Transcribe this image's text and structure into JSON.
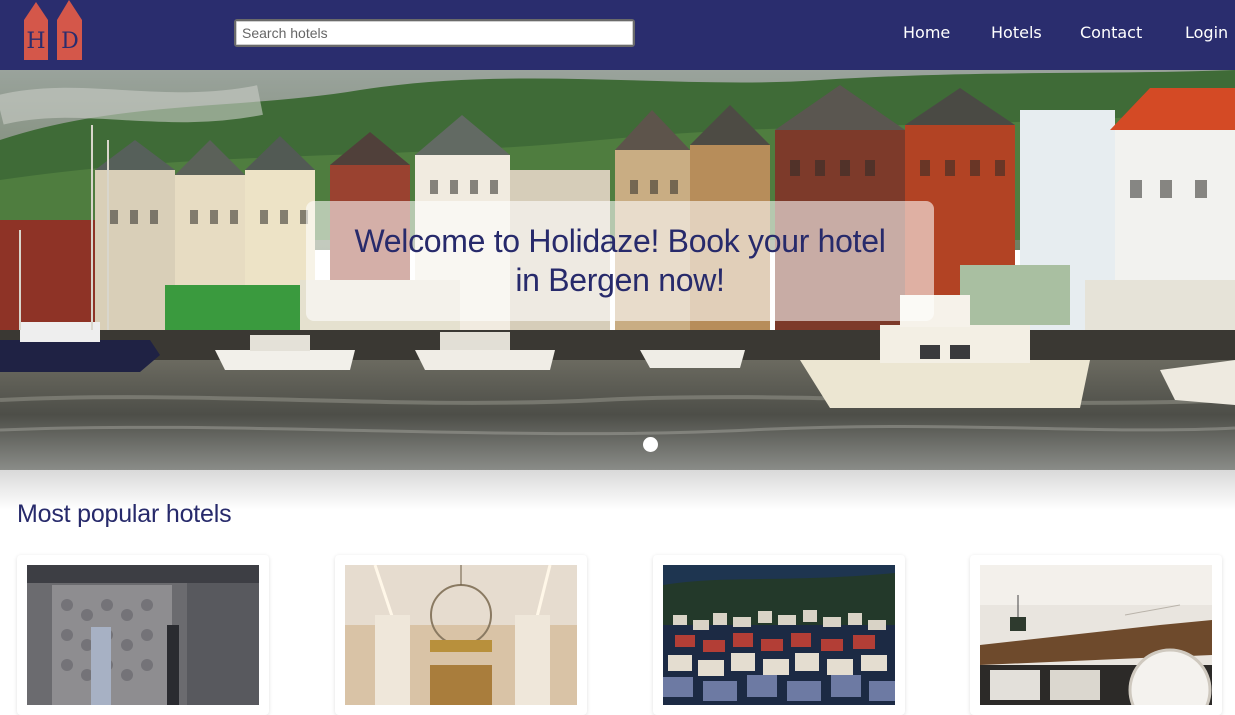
{
  "header": {
    "logo_name": "Holidaze logo",
    "search": {
      "placeholder": "Search hotels",
      "value": ""
    },
    "nav": [
      {
        "label": "Home"
      },
      {
        "label": "Hotels"
      },
      {
        "label": "Contact"
      },
      {
        "label": "Login"
      }
    ]
  },
  "hero": {
    "caption": "Welcome to Holidaze! Book your hotel in Bergen now!",
    "carousel_dots": 1
  },
  "popular": {
    "title": "Most popular hotels",
    "cards": [
      {
        "image": "hotel-room-interior"
      },
      {
        "image": "hotel-lobby-chandelier"
      },
      {
        "image": "bergen-night-view"
      },
      {
        "image": "hotel-reception"
      }
    ]
  },
  "colors": {
    "header_bg": "#2a2d6e",
    "brand_text": "#272a6b",
    "logo_red": "#d4574a"
  }
}
